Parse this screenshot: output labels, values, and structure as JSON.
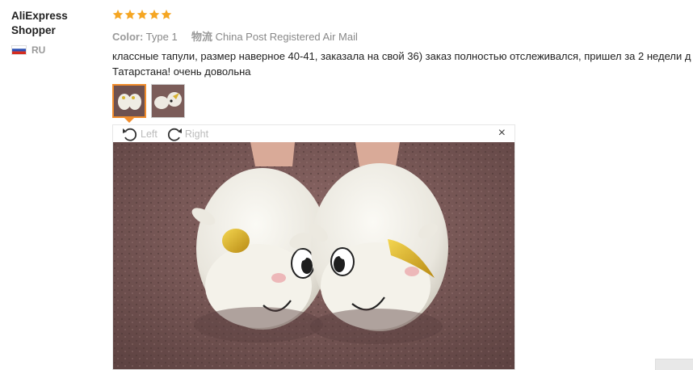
{
  "buyer": {
    "name_line1": "AliExpress",
    "name_line2": "Shopper",
    "country": "RU",
    "flag_colors": [
      "#ffffff",
      "#2c4fb3",
      "#d52b1e"
    ]
  },
  "rating": {
    "stars": 5,
    "max": 5,
    "star_color": "#f5a623"
  },
  "order_info": {
    "color_label": "Color:",
    "color_value": "Type 1",
    "shipping_label": "物流",
    "shipping_value": "China Post Registered Air Mail"
  },
  "feedback": {
    "line1": "классные тапули, размер наверное 40-41, заказала на свой 36) заказ полностью отслеживался, пришел за 2 недели д",
    "line2": "Татарстана! очень довольна"
  },
  "thumbnails": [
    {
      "name": "photo-1",
      "active": true
    },
    {
      "name": "photo-2",
      "active": false
    }
  ],
  "viewer": {
    "rotate_left_label": "Left",
    "rotate_right_label": "Right",
    "close_symbol": "×"
  },
  "colors": {
    "accent_orange": "#f08c2c",
    "text_muted": "#999999",
    "text_main": "#222222"
  }
}
